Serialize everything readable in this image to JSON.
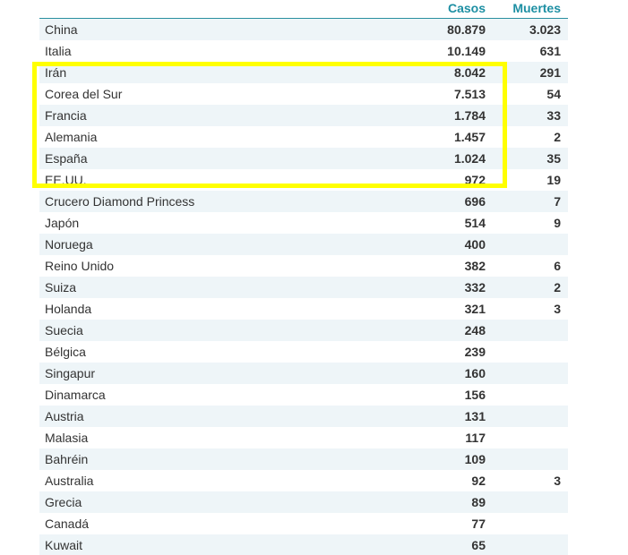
{
  "table": {
    "headers": {
      "cases": "Casos",
      "deaths": "Muertes"
    },
    "rows": [
      {
        "country": "China",
        "cases": "80.879",
        "deaths": "3.023"
      },
      {
        "country": "Italia",
        "cases": "10.149",
        "deaths": "631"
      },
      {
        "country": "Irán",
        "cases": "8.042",
        "deaths": "291"
      },
      {
        "country": "Corea del Sur",
        "cases": "7.513",
        "deaths": "54"
      },
      {
        "country": "Francia",
        "cases": "1.784",
        "deaths": "33"
      },
      {
        "country": "Alemania",
        "cases": "1.457",
        "deaths": "2"
      },
      {
        "country": "España",
        "cases": "1.024",
        "deaths": "35"
      },
      {
        "country": "EE.UU.",
        "cases": "972",
        "deaths": "19"
      },
      {
        "country": "Crucero Diamond Princess",
        "cases": "696",
        "deaths": "7"
      },
      {
        "country": "Japón",
        "cases": "514",
        "deaths": "9"
      },
      {
        "country": "Noruega",
        "cases": "400",
        "deaths": ""
      },
      {
        "country": "Reino Unido",
        "cases": "382",
        "deaths": "6"
      },
      {
        "country": "Suiza",
        "cases": "332",
        "deaths": "2"
      },
      {
        "country": "Holanda",
        "cases": "321",
        "deaths": "3"
      },
      {
        "country": "Suecia",
        "cases": "248",
        "deaths": ""
      },
      {
        "country": "Bélgica",
        "cases": "239",
        "deaths": ""
      },
      {
        "country": "Singapur",
        "cases": "160",
        "deaths": ""
      },
      {
        "country": "Dinamarca",
        "cases": "156",
        "deaths": ""
      },
      {
        "country": "Austria",
        "cases": "131",
        "deaths": ""
      },
      {
        "country": "Malasia",
        "cases": "117",
        "deaths": ""
      },
      {
        "country": "Bahréin",
        "cases": "109",
        "deaths": ""
      },
      {
        "country": "Australia",
        "cases": "92",
        "deaths": "3"
      },
      {
        "country": "Grecia",
        "cases": "89",
        "deaths": ""
      },
      {
        "country": "Canadá",
        "cases": "77",
        "deaths": ""
      },
      {
        "country": "Kuwait",
        "cases": "65",
        "deaths": ""
      }
    ]
  },
  "colors": {
    "header_text": "#1d8fa3",
    "row_alt_bg": "#eef5f8",
    "highlight_border": "#ffff00"
  }
}
